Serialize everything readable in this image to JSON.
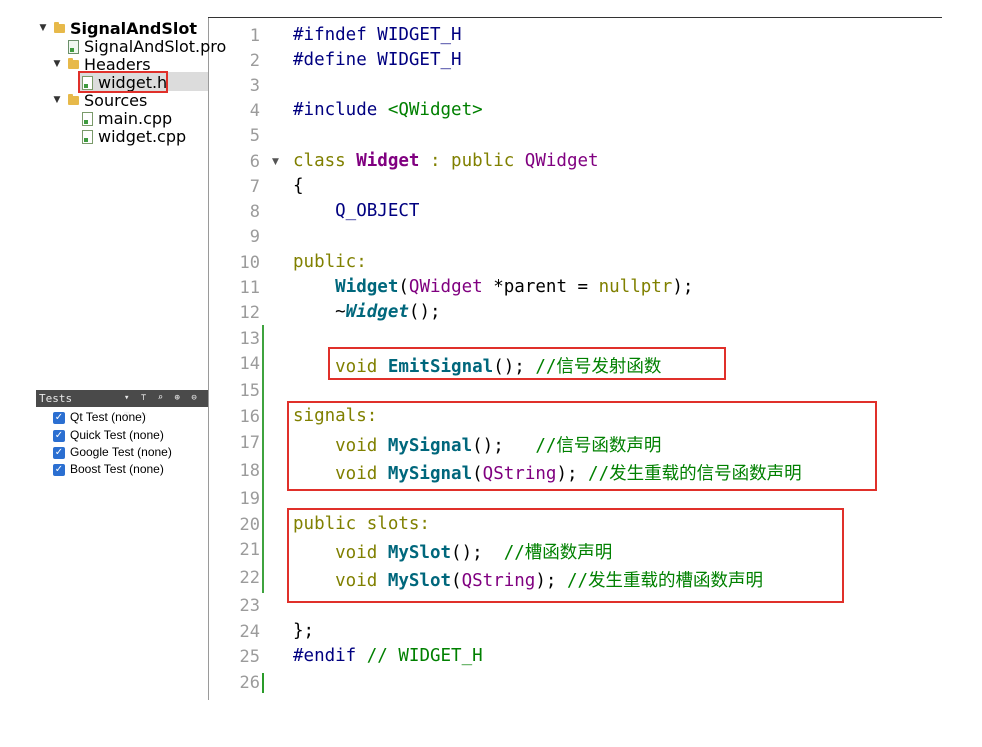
{
  "project_tree": {
    "project_name": "SignalAndSlot",
    "pro_file": "SignalAndSlot.pro",
    "headers_label": "Headers",
    "header_file": "widget.h",
    "sources_label": "Sources",
    "source_files": [
      "main.cpp",
      "widget.cpp"
    ]
  },
  "tests": {
    "title": "Tests",
    "toolbar_glyphs": "▾ ⊤ ⌕ ⊕ ⊖ ⊞ ▭",
    "items": [
      "Qt Test (none)",
      "Quick Test (none)",
      "Google Test (none)",
      "Boost Test (none)"
    ]
  },
  "editor": {
    "line_numbers": [
      "1",
      "2",
      "3",
      "4",
      "5",
      "6",
      "7",
      "8",
      "9",
      "10",
      "11",
      "12",
      "13",
      "14",
      "15",
      "16",
      "17",
      "18",
      "19",
      "20",
      "21",
      "22",
      "23",
      "24",
      "25",
      "26"
    ],
    "lines": {
      "l1": "#ifndef WIDGET_H",
      "l2": "#define WIDGET_H",
      "l4a": "#include ",
      "l4b": "<QWidget>",
      "l6a": "class ",
      "l6b": "Widget",
      "l6c": " : public ",
      "l6d": "QWidget",
      "l7": "{",
      "l8": "    Q_OBJECT",
      "l10": "public:",
      "l11a": "    ",
      "l11b": "Widget",
      "l11c": "(",
      "l11d": "QWidget",
      "l11e": " *parent = ",
      "l11f": "nullptr",
      "l11g": ");",
      "l12a": "    ~",
      "l12b": "Widget",
      "l12c": "();",
      "l14a": "    void ",
      "l14b": "EmitSignal",
      "l14c": "(); ",
      "l14d": "//信号发射函数",
      "l16": "signals:",
      "l17a": "    void ",
      "l17b": "MySignal",
      "l17c": "();   ",
      "l17d": "//信号函数声明",
      "l18a": "    void ",
      "l18b": "MySignal",
      "l18c": "(",
      "l18d": "QString",
      "l18e": "); ",
      "l18f": "//发生重载的信号函数声明",
      "l20": "public slots:",
      "l21a": "    void ",
      "l21b": "MySlot",
      "l21c": "();  ",
      "l21d": "//槽函数声明",
      "l22a": "    void ",
      "l22b": "MySlot",
      "l22c": "(",
      "l22d": "QString",
      "l22e": "); ",
      "l22f": "//发生重载的槽函数声明",
      "l24": "};",
      "l25a": "#endif ",
      "l25b": "// WIDGET_H"
    }
  },
  "colors": {
    "highlight_box": "#e0302a",
    "keyword": "#808000",
    "class_name": "#800080",
    "function": "#00677c",
    "comment": "#008000",
    "preprocessor": "#000080"
  }
}
